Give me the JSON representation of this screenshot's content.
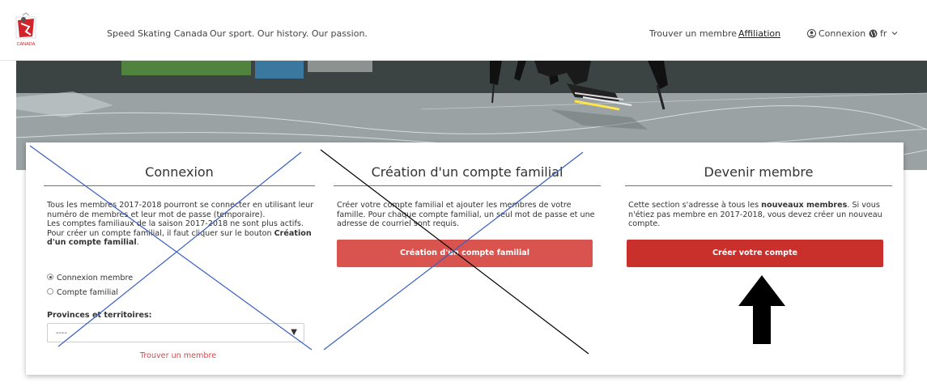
{
  "header": {
    "brand": "Speed Skating Canada",
    "tagline": "Our sport. Our history. Our passion.",
    "logo_text": "CANADA",
    "nav": {
      "find_member": "Trouver un membre",
      "affiliation": "Affiliation",
      "login": "Connexion",
      "language": "fr"
    }
  },
  "login": {
    "title": "Connexion",
    "text_intro": "Tous les membres 2017-2018 pourront se connecter en utilisant leur numéro de membres et leur mot de passe (temporaire).",
    "text_family": "Les comptes familiaux de la saison 2017-2018 ne sont plus actifs. Pour créer un compte familial, il faut cliquer sur le bouton ",
    "text_family_bold": "Création d'un compte familial",
    "text_family_end": ".",
    "radio_member": "Connexion membre",
    "radio_family": "Compte familial",
    "province_label": "Provinces et territoires:",
    "province_value": "----",
    "find_member_link": "Trouver un membre"
  },
  "family": {
    "title": "Création d'un compte familial",
    "text": "Créer votre compte familial et ajouter les membres de votre famille. Pour chaque compte familial, un seul mot de passe et une adresse de courriel sont requis.",
    "button": "Création d'un compte familial"
  },
  "member": {
    "title": "Devenir membre",
    "text_start": "Cette section s'adresse à tous les ",
    "text_bold": "nouveaux membres",
    "text_end": ". Si vous n'étiez pas membre en 2017-2018, vous devez créer un nouveau compte.",
    "button": "Créer votre compte"
  },
  "colors": {
    "accent_red": "#d14a4f",
    "button_light": "#d9534f",
    "button_dark": "#c9302c",
    "cross_blue": "#3a5fc4",
    "cross_black": "#000000"
  }
}
